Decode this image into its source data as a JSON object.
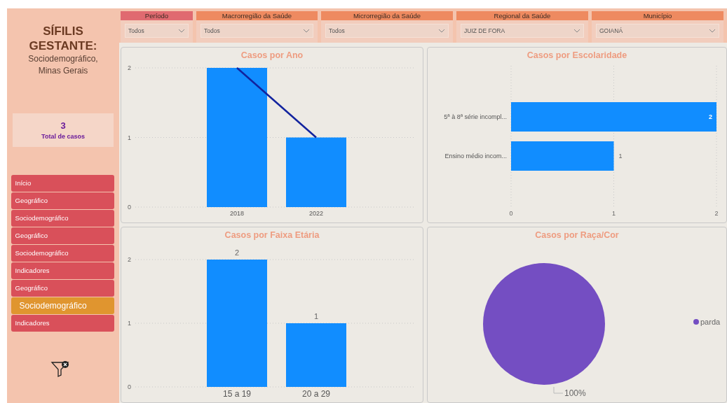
{
  "sidebar": {
    "title": "SÍFILIS GESTANTE:",
    "subtitle": "Sociodemográfico, Minas Gerais",
    "total": {
      "value": "3",
      "label": "Total de casos"
    },
    "nav": [
      {
        "label": "Início",
        "selected": false
      },
      {
        "label": "Geográfico",
        "selected": false
      },
      {
        "label": "Sociodemográfico",
        "selected": false
      },
      {
        "label": "Geográfico",
        "selected": false
      },
      {
        "label": "Sociodemográfico",
        "selected": false
      },
      {
        "label": "Indicadores",
        "selected": false
      },
      {
        "label": "Geográfico",
        "selected": false
      },
      {
        "label": "Sociodemográfico",
        "selected": true
      },
      {
        "label": "Indicadores",
        "selected": false
      }
    ]
  },
  "filters": [
    {
      "label": "Período",
      "value": "Todos",
      "color": "#e06a70"
    },
    {
      "label": "Macrorregião da Saúde",
      "value": "Todos",
      "color": "#ee8a60"
    },
    {
      "label": "Microrregião da Saúde",
      "value": "Todos",
      "color": "#ee8a60"
    },
    {
      "label": "Regional da Saúde",
      "value": "JUIZ DE FORA",
      "color": "#ee8a60"
    },
    {
      "label": "Município",
      "value": "GOIANÁ",
      "color": "#ee8a60"
    }
  ],
  "charts": [
    {
      "chart_data": {
        "type": "bar",
        "title": "Casos por Ano",
        "categories": [
          "2018",
          "2022"
        ],
        "series": [
          {
            "type": "bar",
            "color": "#118dff",
            "values": [
              2,
              1
            ]
          },
          {
            "type": "line",
            "color": "#12239e",
            "values": [
              2,
              1
            ]
          }
        ],
        "ylim": [
          0,
          2
        ],
        "yticks": [
          0,
          1,
          2
        ]
      }
    },
    {
      "chart_data": {
        "type": "bar",
        "orientation": "horizontal",
        "title": "Casos por Escolaridade",
        "categories": [
          "5ª à 8ª série incompl...",
          "Ensino médio incom..."
        ],
        "series": [
          {
            "color": "#118dff",
            "values": [
              2,
              1
            ]
          }
        ],
        "xlim": [
          0,
          2
        ],
        "xticks": [
          0,
          1,
          2
        ],
        "data_labels": true
      }
    },
    {
      "chart_data": {
        "type": "bar",
        "title": "Casos por Faixa Etária",
        "categories": [
          "15 a 19",
          "20 a 29"
        ],
        "series": [
          {
            "color": "#118dff",
            "values": [
              2,
              1
            ]
          }
        ],
        "ylim": [
          0,
          2
        ],
        "yticks": [
          0,
          1,
          2
        ],
        "data_labels": true
      }
    },
    {
      "chart_data": {
        "type": "pie",
        "title": "Casos por Raça/Cor",
        "categories": [
          "parda"
        ],
        "series": [
          {
            "color": "#744ec2",
            "values": [
              1
            ]
          }
        ],
        "value_labels": [
          "100%"
        ]
      }
    }
  ]
}
